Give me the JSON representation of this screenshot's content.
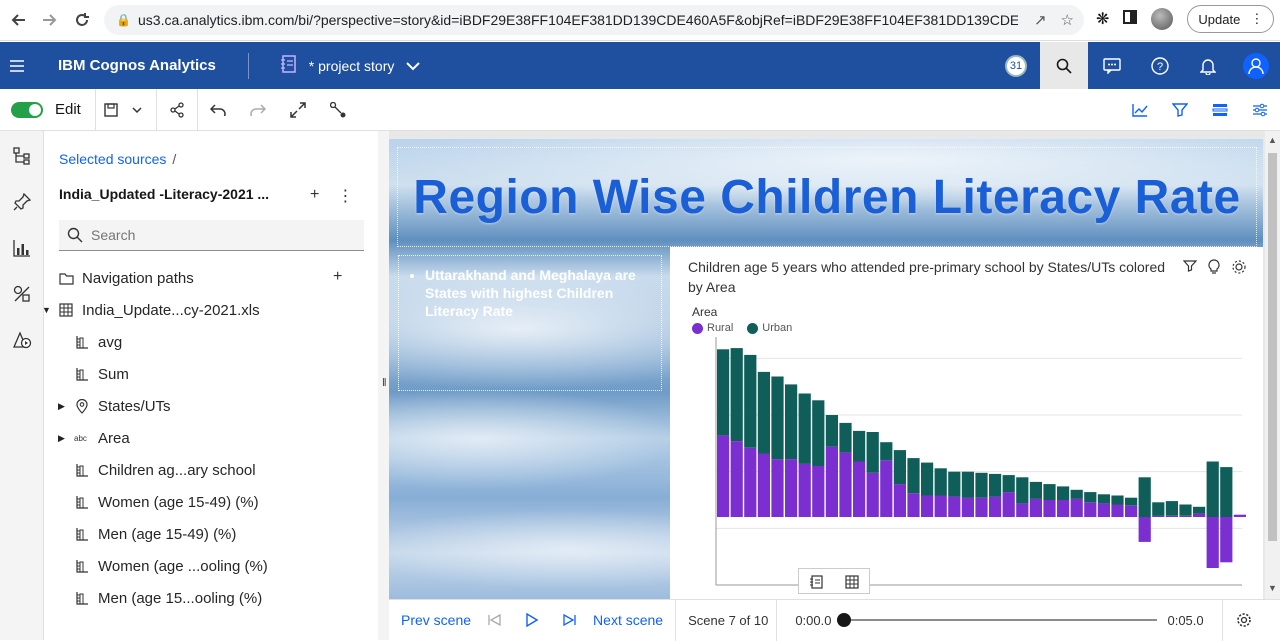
{
  "browser": {
    "url": "us3.ca.analytics.ibm.com/bi/?perspective=story&id=iBDF29E38FF104EF381DD139CDE460A5F&objRef=iBDF29E38FF104EF381DD139CDE460...",
    "update_label": "Update"
  },
  "header": {
    "brand": "IBM Cognos Analytics",
    "story_name": "* project story",
    "user_badge": "31"
  },
  "toolbar": {
    "edit_label": "Edit"
  },
  "panel": {
    "breadcrumb_link": "Selected sources",
    "breadcrumb_sep": "/",
    "source_name": "India_Updated -Literacy-2021 ...",
    "search_placeholder": "Search",
    "tree": [
      {
        "label": "Navigation paths",
        "icon": "folder-icon",
        "caret": "",
        "indent": 58
      },
      {
        "label": "India_Update...cy-2021.xls",
        "icon": "table-icon",
        "caret": "down",
        "indent": 58
      },
      {
        "label": "avg",
        "icon": "measure-icon",
        "caret": "",
        "indent": 74
      },
      {
        "label": "Sum",
        "icon": "measure-icon",
        "caret": "",
        "indent": 74
      },
      {
        "label": "States/UTs",
        "icon": "location-icon",
        "caret": "right",
        "indent": 74
      },
      {
        "label": "Area",
        "icon": "text-abc-icon",
        "caret": "right",
        "indent": 74
      },
      {
        "label": "Children ag...ary school",
        "icon": "measure-icon",
        "caret": "",
        "indent": 74
      },
      {
        "label": "Women (age 15-49) (%)",
        "icon": "measure-icon",
        "caret": "",
        "indent": 74
      },
      {
        "label": "Men (age 15-49) (%)",
        "icon": "measure-icon",
        "caret": "",
        "indent": 74
      },
      {
        "label": "Women (age ...ooling (%)",
        "icon": "measure-icon",
        "caret": "",
        "indent": 74
      },
      {
        "label": "Men (age 15...ooling (%)",
        "icon": "measure-icon",
        "caret": "",
        "indent": 74
      }
    ]
  },
  "scene": {
    "title": "Region Wise Children Literacy Rate",
    "note": "Uttarakhand and Meghalaya are States with highest Children Literacy Rate"
  },
  "chart_data": {
    "type": "bar",
    "title": "Children age 5 years who attended pre-primary school by States/UTs colored by Area",
    "legend_title": "Area",
    "stacked": true,
    "legend_position": "top-left",
    "grid": true,
    "series": [
      {
        "name": "Rural",
        "color": "#7b2fd0",
        "values": [
          72,
          67,
          61,
          56,
          51,
          51,
          47,
          45,
          62,
          57,
          49,
          39,
          50,
          29,
          21,
          19,
          19,
          18,
          17,
          17,
          18,
          22,
          12,
          16,
          15,
          15,
          16,
          13,
          12,
          11,
          10,
          -22,
          1,
          1,
          1,
          3,
          -45,
          -40,
          2
        ]
      },
      {
        "name": "Urban",
        "color": "#0f5e59",
        "values": [
          76,
          82,
          82,
          72,
          73,
          66,
          62,
          58,
          28,
          26,
          27,
          36,
          16,
          30,
          31,
          29,
          24,
          22,
          23,
          22,
          20,
          15,
          23,
          15,
          14,
          12,
          8,
          9,
          8,
          8,
          7,
          35,
          12,
          13,
          10,
          6,
          49,
          44,
          0
        ]
      }
    ],
    "ylim": [
      -60,
      150
    ]
  },
  "timeline": {
    "prev": "Prev scene",
    "next": "Next scene",
    "scene_count": "Scene 7 of 10",
    "start_time": "0:00.0",
    "end_time": "0:05.0",
    "progress": 0
  }
}
